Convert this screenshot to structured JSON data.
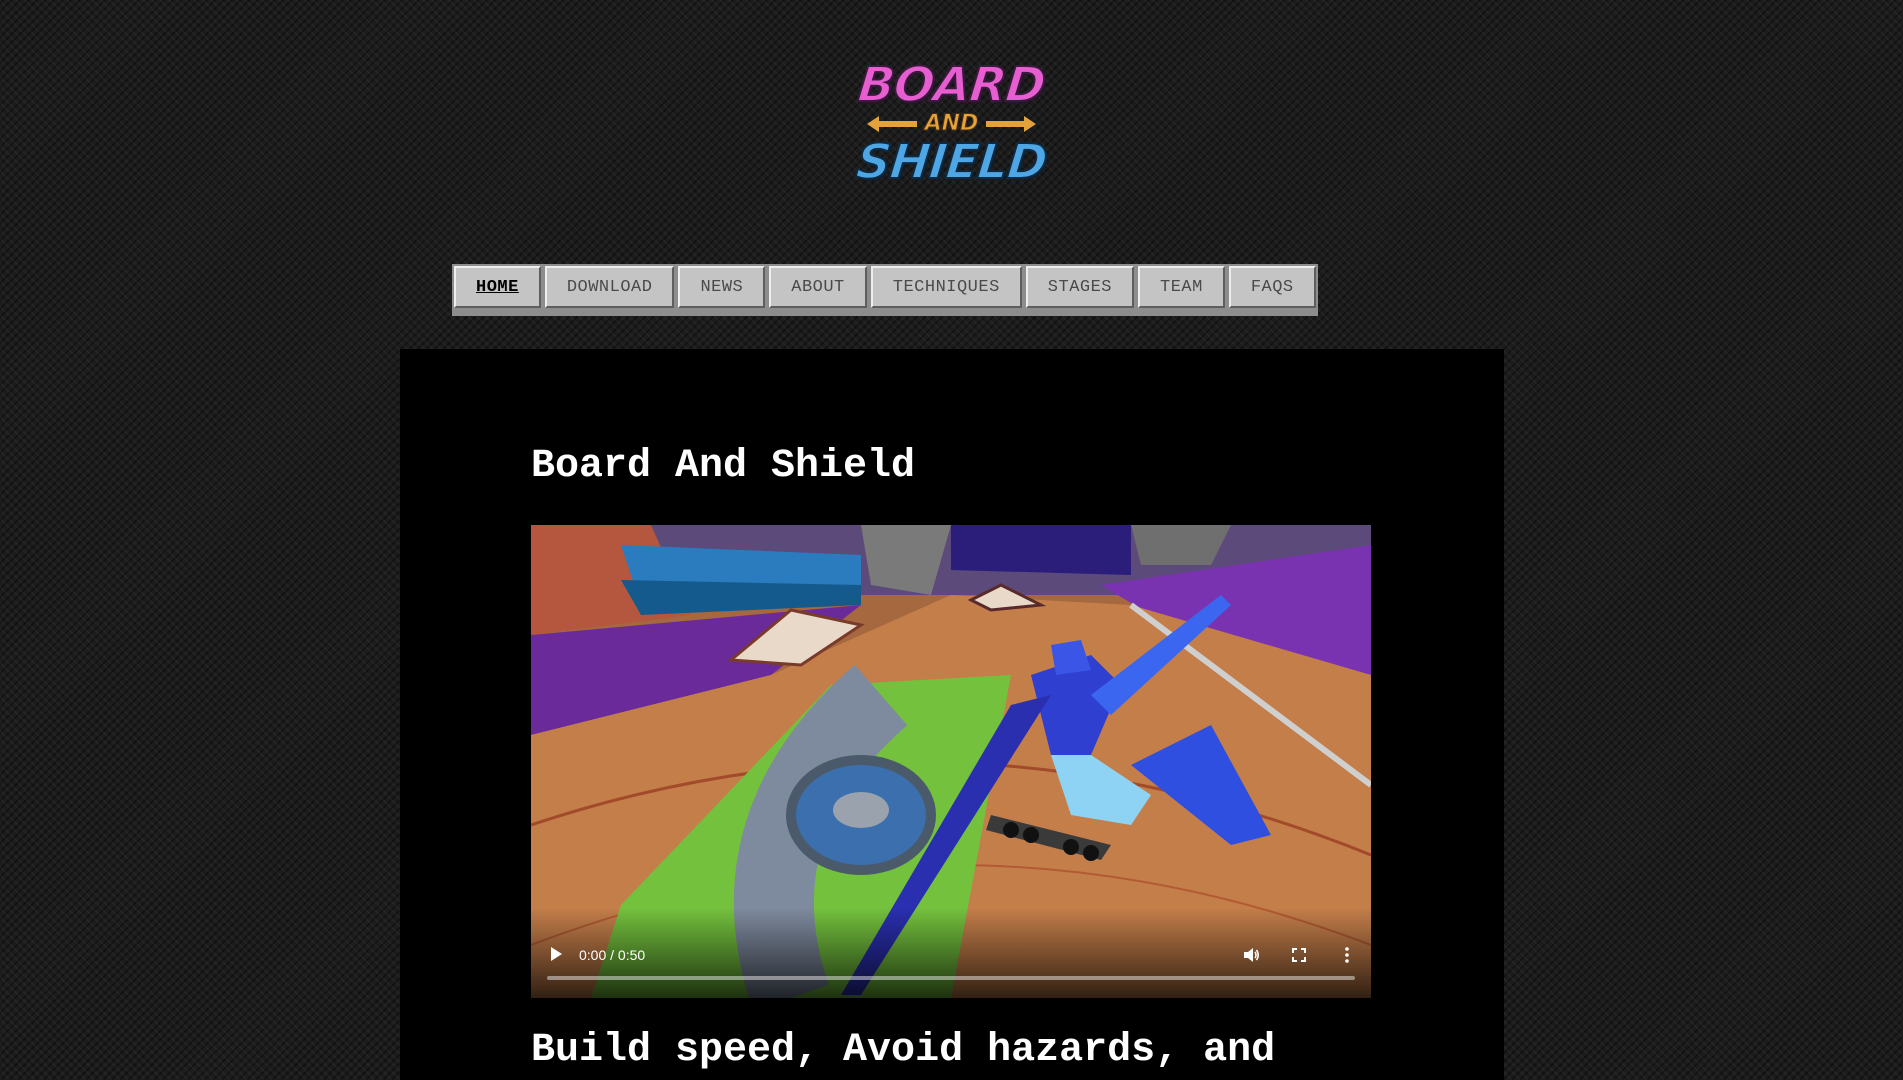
{
  "logo": {
    "line1": "BOARD",
    "middle": "AND",
    "line2": "SHIELD"
  },
  "nav": {
    "items": [
      {
        "label": "HOME",
        "active": true
      },
      {
        "label": "DOWNLOAD",
        "active": false
      },
      {
        "label": "NEWS",
        "active": false
      },
      {
        "label": "ABOUT",
        "active": false
      },
      {
        "label": "TECHNIQUES",
        "active": false
      },
      {
        "label": "STAGES",
        "active": false
      },
      {
        "label": "TEAM",
        "active": false
      },
      {
        "label": "FAQS",
        "active": false
      }
    ]
  },
  "main": {
    "title": "Board And Shield",
    "tagline": "Build speed, Avoid hazards, and"
  },
  "video": {
    "time": "0:00 / 0:50",
    "progress": 0,
    "icons": {
      "play": "play-icon",
      "volume": "volume-icon",
      "fullscreen": "fullscreen-icon",
      "more": "more-options-icon"
    }
  },
  "colors": {
    "page_background": "#1c1c1c",
    "panel_background": "#000000",
    "nav_button": "#c4c4c4",
    "logo_pink": "#e65ed0",
    "logo_orange": "#e3a33a",
    "logo_blue": "#4ea7e4"
  }
}
